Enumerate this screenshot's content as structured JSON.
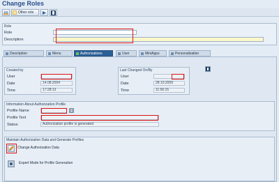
{
  "window": {
    "title": "Change Roles"
  },
  "toolbar": {
    "other_role_label": "Other role"
  },
  "role": {
    "group_title": "Role",
    "role_label": "Role",
    "description_label": "Description",
    "role_value": "",
    "description_value": ""
  },
  "tabs": [
    {
      "label": "Description",
      "active": false
    },
    {
      "label": "Menu",
      "active": false
    },
    {
      "label": "Authorizations",
      "active": true
    },
    {
      "label": "User",
      "active": false
    },
    {
      "label": "MiniApps",
      "active": false
    },
    {
      "label": "Personalization",
      "active": false
    }
  ],
  "created_by": {
    "title": "Created by",
    "user_label": "User",
    "date_label": "Date",
    "time_label": "Time",
    "user_value": "",
    "date_value": "14.08.2004",
    "time_value": "17:28:13"
  },
  "last_changed": {
    "title": "Last Changed On/By",
    "user_label": "User",
    "date_label": "Date",
    "time_label": "Time",
    "user_value": "",
    "date_value": "28.10.2009",
    "time_value": "11:56:15"
  },
  "auth_profile": {
    "title": "Information About Authorization Profile",
    "profile_name_label": "Profile Name",
    "profile_text_label": "Profile Text",
    "status_label": "Status",
    "status_value": "Authorization profile is generated"
  },
  "maintain": {
    "title": "Maintain Authorization Data and Generate Profiles",
    "change_label": "Change Authorization Data",
    "expert_label": "Expert Mode for Profile Generation"
  },
  "colors": {
    "accent": "#2d5f97",
    "highlight": "#d11111",
    "description_field": "#fbf7c8"
  }
}
